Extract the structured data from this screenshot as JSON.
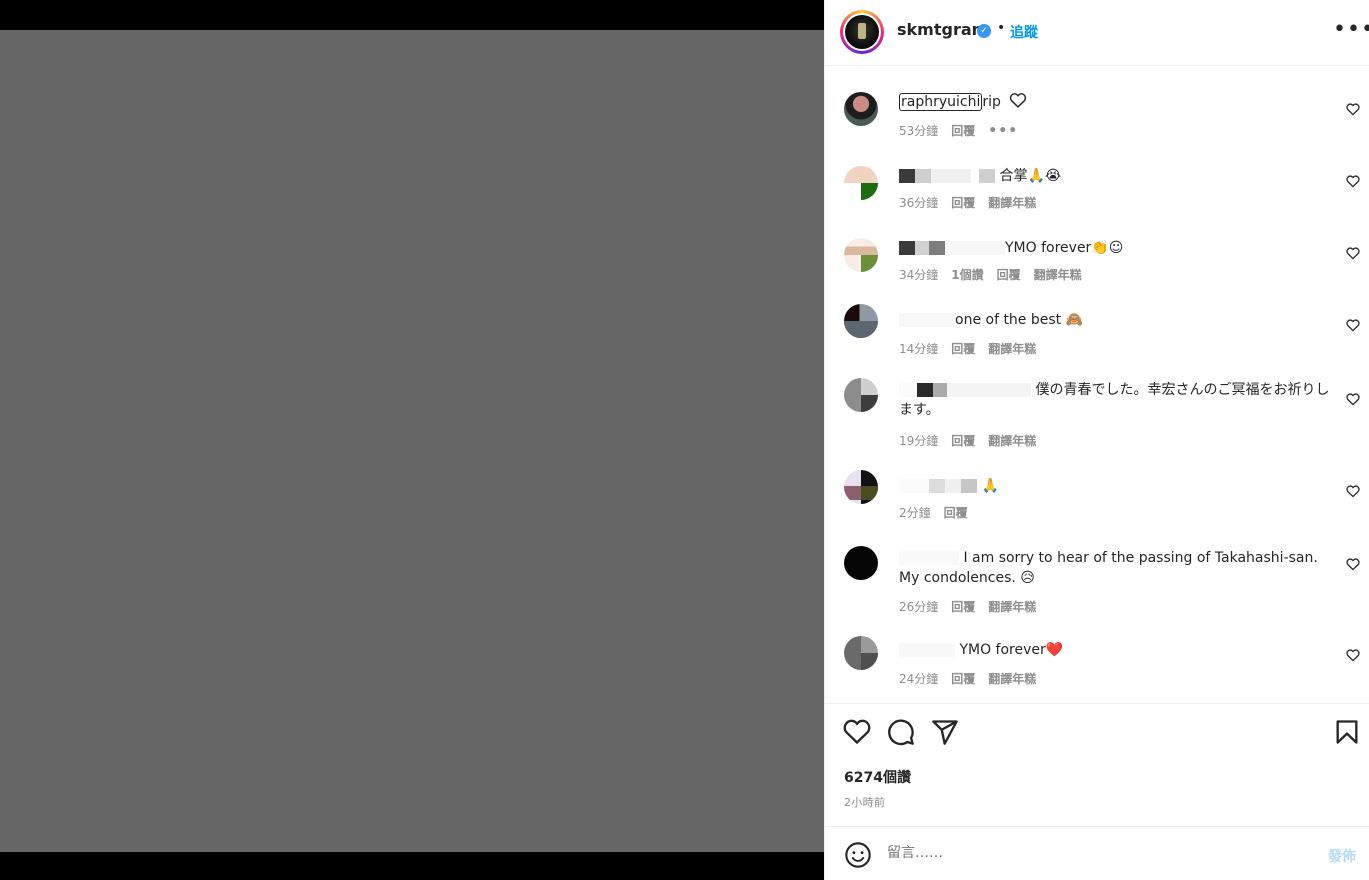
{
  "post": {
    "username": "skmtgram",
    "separator": "•",
    "follow_label": "追蹤",
    "more_label": "•••"
  },
  "comments": [
    {
      "user": "raphryuichi",
      "text": "rip",
      "time": "53分鐘",
      "likes": "",
      "reply": "回覆",
      "translate": "",
      "more": "•••"
    },
    {
      "user": "",
      "text": "合掌🙏😭",
      "time": "36分鐘",
      "likes": "",
      "reply": "回覆",
      "translate": "翻譯年糕"
    },
    {
      "user": "",
      "text": "YMO forever👏☺",
      "time": "34分鐘",
      "likes": "1個讚",
      "reply": "回覆",
      "translate": "翻譯年糕"
    },
    {
      "user": "",
      "text": "one of the best 🙈",
      "time": "14分鐘",
      "likes": "",
      "reply": "回覆",
      "translate": "翻譯年糕"
    },
    {
      "user": "",
      "text": "僕の青春でした。幸宏さんのご冥福をお祈りします。",
      "time": "19分鐘",
      "likes": "",
      "reply": "回覆",
      "translate": "翻譯年糕"
    },
    {
      "user": "",
      "text": "🙏",
      "time": "2分鐘",
      "likes": "",
      "reply": "回覆",
      "translate": ""
    },
    {
      "user": "",
      "text": "I am sorry to hear of the passing of Takahashi-san. My condolences. 😥",
      "time": "26分鐘",
      "likes": "",
      "reply": "回覆",
      "translate": "翻譯年糕"
    },
    {
      "user": "",
      "text": "YMO forever❤️",
      "time": "24分鐘",
      "likes": "",
      "reply": "回覆",
      "translate": "翻譯年糕"
    }
  ],
  "stats": {
    "likes": "6274個讚",
    "posted": "2小時前"
  },
  "composer": {
    "placeholder": "留言……",
    "post_label": "發佈"
  }
}
